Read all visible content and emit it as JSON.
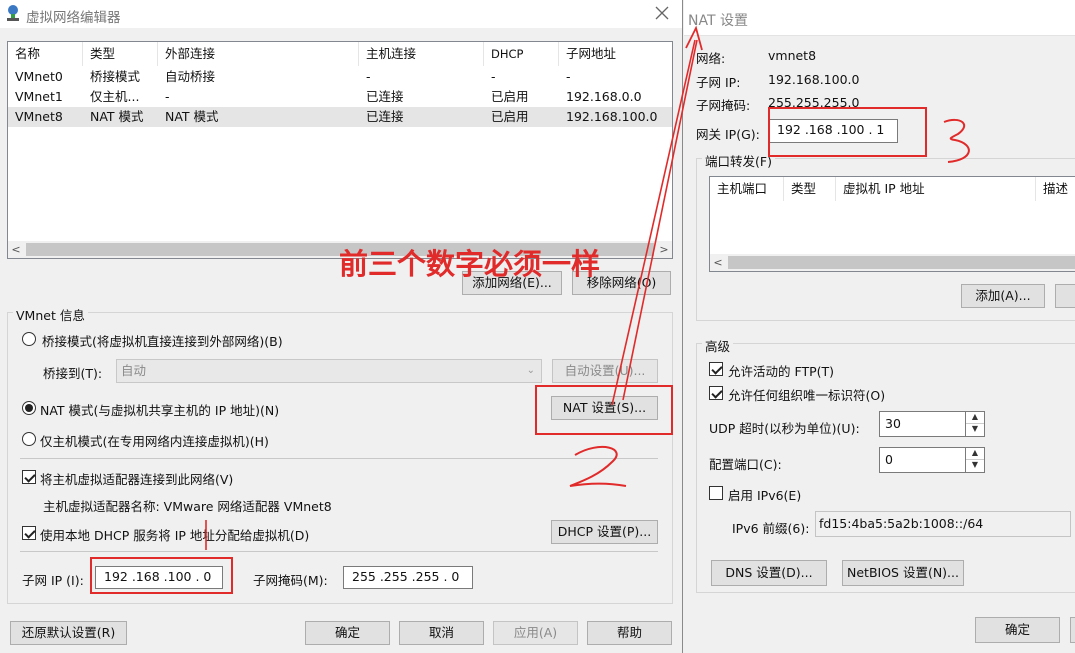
{
  "left_window": {
    "title": "虚拟网络编辑器",
    "table": {
      "headers": [
        "名称",
        "类型",
        "外部连接",
        "主机连接",
        "DHCP",
        "子网地址"
      ],
      "rows": [
        [
          "VMnet0",
          "桥接模式",
          "自动桥接",
          "-",
          "-",
          "-"
        ],
        [
          "VMnet1",
          "仅主机...",
          "-",
          "已连接",
          "已启用",
          "192.168.0.0"
        ],
        [
          "VMnet8",
          "NAT 模式",
          "NAT 模式",
          "已连接",
          "已启用",
          "192.168.100.0"
        ]
      ]
    },
    "add_network": "添加网络(E)...",
    "remove_network": "移除网络(O)",
    "vmnet_info": "VMnet 信息",
    "bridged_mode": "桥接模式(将虚拟机直接连接到外部网络)(B)",
    "bridged_to_label": "桥接到(T):",
    "bridged_to_value": "自动",
    "auto_settings": "自动设置(U)...",
    "nat_mode": "NAT 模式(与虚拟机共享主机的 IP 地址)(N)",
    "nat_settings": "NAT 设置(S)...",
    "host_only_mode": "仅主机模式(在专用网络内连接虚拟机)(H)",
    "connect_adapter": "将主机虚拟适配器连接到此网络(V)",
    "adapter_name": "主机虚拟适配器名称: VMware 网络适配器 VMnet8",
    "use_dhcp": "使用本地 DHCP 服务将 IP 地址分配给虚拟机(D)",
    "dhcp_settings": "DHCP 设置(P)...",
    "subnet_ip_label": "子网 IP (I):",
    "subnet_ip_value": "192 .168 .100 .  0",
    "subnet_mask_label": "子网掩码(M):",
    "subnet_mask_value": "255 .255 .255 .  0",
    "restore_defaults": "还原默认设置(R)",
    "ok": "确定",
    "cancel": "取消",
    "apply": "应用(A)",
    "help": "帮助"
  },
  "right_window": {
    "title": "NAT 设置",
    "network_label": "网络:",
    "network_value": "vmnet8",
    "subnet_ip_label": "子网 IP:",
    "subnet_ip_value": "192.168.100.0",
    "subnet_mask_label": "子网掩码:",
    "subnet_mask_value": "255.255.255.0",
    "gateway_label": "网关 IP(G):",
    "gateway_value": "192 .168 .100 .  1",
    "port_forwarding": "端口转发(F)",
    "pf_headers": [
      "主机端口",
      "类型",
      "虚拟机 IP 地址",
      "描述"
    ],
    "add_button": "添加(A)...",
    "advanced": "高级",
    "allow_ftp": "允许活动的 FTP(T)",
    "allow_oui": "允许任何组织唯一标识符(O)",
    "udp_timeout_label": "UDP 超时(以秒为单位)(U):",
    "udp_timeout_value": "30",
    "config_port_label": "配置端口(C):",
    "config_port_value": "0",
    "enable_ipv6": "启用 IPv6(E)",
    "ipv6_prefix_label": "IPv6 前缀(6):",
    "ipv6_prefix_value": "fd15:4ba5:5a2b:1008::/64",
    "dns_settings": "DNS 设置(D)...",
    "netbios_settings": "NetBIOS 设置(N)...",
    "ok": "确定"
  },
  "annotations": {
    "headline": "前三个数字必须一样",
    "mark_two": "2",
    "mark_three": "3",
    "color": "#e12a2a"
  }
}
